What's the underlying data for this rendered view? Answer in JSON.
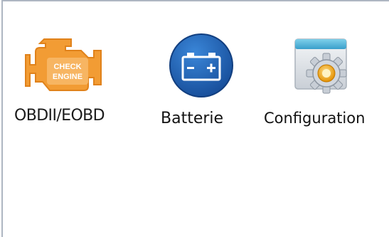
{
  "apps": [
    {
      "label": "OBDII/EOBD",
      "icon": "check-engine-icon",
      "icon_text_line1": "CHECK",
      "icon_text_line2": "ENGINE",
      "color": "#f19a34"
    },
    {
      "label": "Batterie",
      "icon": "battery-icon",
      "color": "#1f5fb0"
    },
    {
      "label": "Configuration",
      "icon": "settings-gear-icon",
      "color": "#f4a300"
    }
  ]
}
